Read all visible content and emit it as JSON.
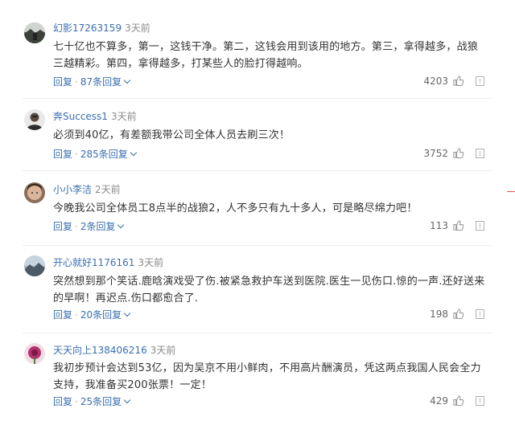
{
  "comments": [
    {
      "username": "幻影17263159",
      "time": "3天前",
      "text": "七十亿也不算多，第一，这钱干净。第二，这钱会用到该用的地方。第三，拿得越多，战狼三越精彩。第四，拿得越多，打某些人的脸打得越响。",
      "reply_label": "回复",
      "reply_count": "87条回复",
      "likes": "4203",
      "avatar": "photo-dark-landscape"
    },
    {
      "username": "奔Success1",
      "time": "3天前",
      "text": "必须到40亿，有差额我带公司全体人员去刷三次！",
      "reply_label": "回复",
      "reply_count": "285条回复",
      "likes": "3752",
      "avatar": "photo-person"
    },
    {
      "username": "小小李洁",
      "time": "2天前",
      "text": "今晚我公司全体员工8点半的战狼2，人不多只有九十多人，可是略尽绵力吧！",
      "reply_label": "回复",
      "reply_count": "2条回复",
      "likes": "113",
      "avatar": "photo-face"
    },
    {
      "username": "开心就好1176161",
      "time": "3天前",
      "text": "突然想到那个笑话.鹿晗演戏受了伤.被紧急救护车送到医院.医生一见伤口.惊的一声.还好送来的早啊！再迟点.伤口都愈合了.",
      "reply_label": "回复",
      "reply_count": "20条回复",
      "likes": "198",
      "avatar": "photo-mountain"
    },
    {
      "username": "天天向上138406216",
      "time": "3天前",
      "text": "我初步预计会达到53亿，因为吴京不用小鲜肉，不用高片酬演员，凭这两点我国人民会全力支持，我准备买200张票！一定！",
      "reply_label": "回复",
      "reply_count": "25条回复",
      "likes": "429",
      "avatar": "photo-flower"
    }
  ],
  "colors": {
    "link": "#3a6fb0",
    "muted": "#8a8a8a",
    "text": "#333333",
    "divider": "#ececec"
  },
  "icons": {
    "like": "thumbs-up-icon",
    "report": "report-icon",
    "expand": "chevron-down-icon"
  }
}
